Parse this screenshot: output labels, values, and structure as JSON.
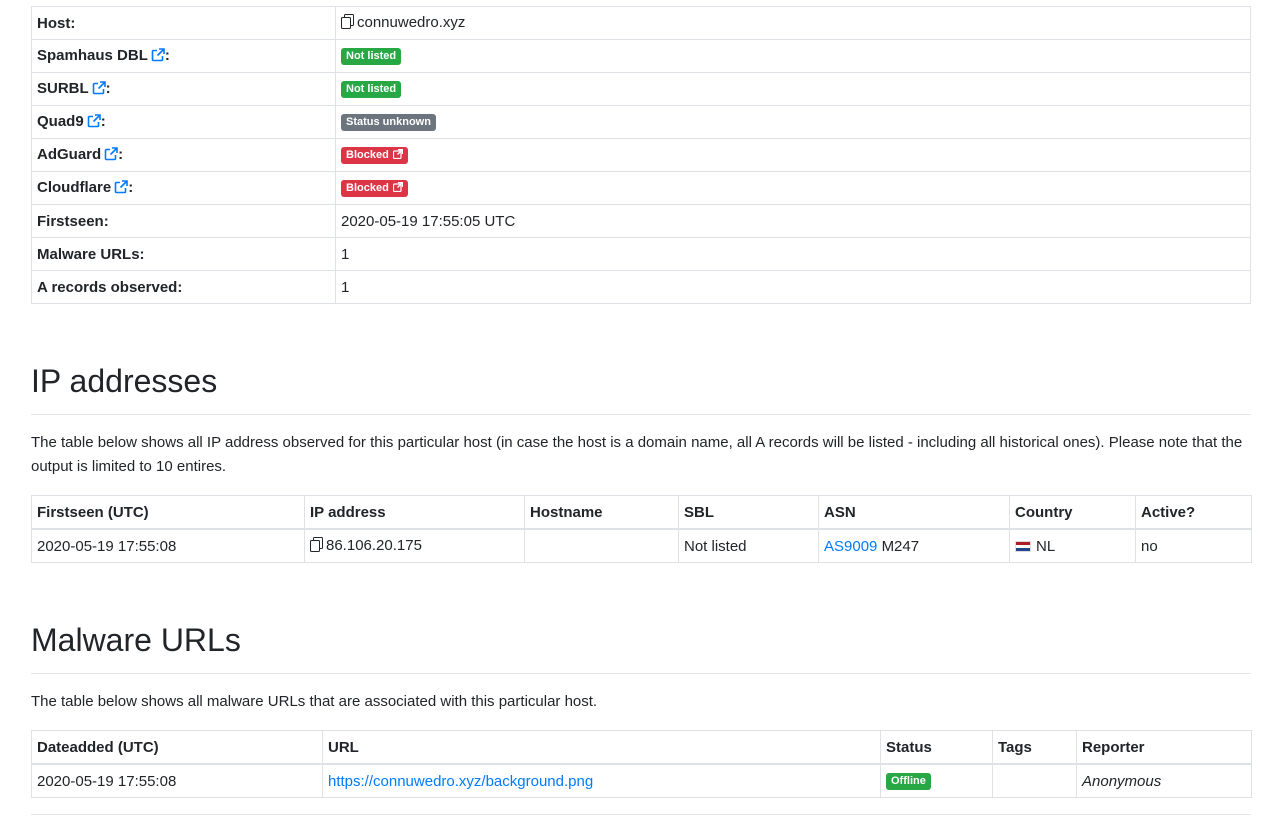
{
  "info": {
    "rows": [
      {
        "label": "Host:",
        "value": "connuwedro.xyz"
      },
      {
        "label": "Spamhaus DBL",
        "badge": "Not listed"
      },
      {
        "label": "SURBL",
        "badge": "Not listed"
      },
      {
        "label": "Quad9",
        "badge": "Status unknown"
      },
      {
        "label": "AdGuard",
        "badge": "Blocked"
      },
      {
        "label": "Cloudflare",
        "badge": "Blocked"
      },
      {
        "label": "Firstseen:",
        "value": "2020-05-19 17:55:05 UTC"
      },
      {
        "label": "Malware URLs:",
        "value": "1"
      },
      {
        "label": "A records observed:",
        "value": "1"
      }
    ],
    "colon": ":"
  },
  "ip_section": {
    "title": "IP addresses",
    "description": "The table below shows all IP address observed for this particular host (in case the host is a domain name, all A records will be listed - including all historical ones). Please note that the output is limited to 10 entires.",
    "headers": [
      "Firstseen (UTC)",
      "IP address",
      "Hostname",
      "SBL",
      "ASN",
      "Country",
      "Active?"
    ],
    "rows": [
      {
        "firstseen": "2020-05-19 17:55:08",
        "ip": "86.106.20.175",
        "hostname": "",
        "sbl": "Not listed",
        "asn_link": "AS9009",
        "asn_name": "M247",
        "country": "NL",
        "active": "no"
      }
    ]
  },
  "malware_section": {
    "title": "Malware URLs",
    "description": "The table below shows all malware URLs that are associated with this particular host.",
    "headers": [
      "Dateadded (UTC)",
      "URL",
      "Status",
      "Tags",
      "Reporter"
    ],
    "rows": [
      {
        "dateadded": "2020-05-19 17:55:08",
        "url": "https://connuwedro.xyz/background.png",
        "status": "Offline",
        "tags": "",
        "reporter": "Anonymous"
      }
    ]
  },
  "colors": {
    "link": "#007bff",
    "green": "#28a745",
    "gray": "#6c757d",
    "red": "#dc3545"
  }
}
